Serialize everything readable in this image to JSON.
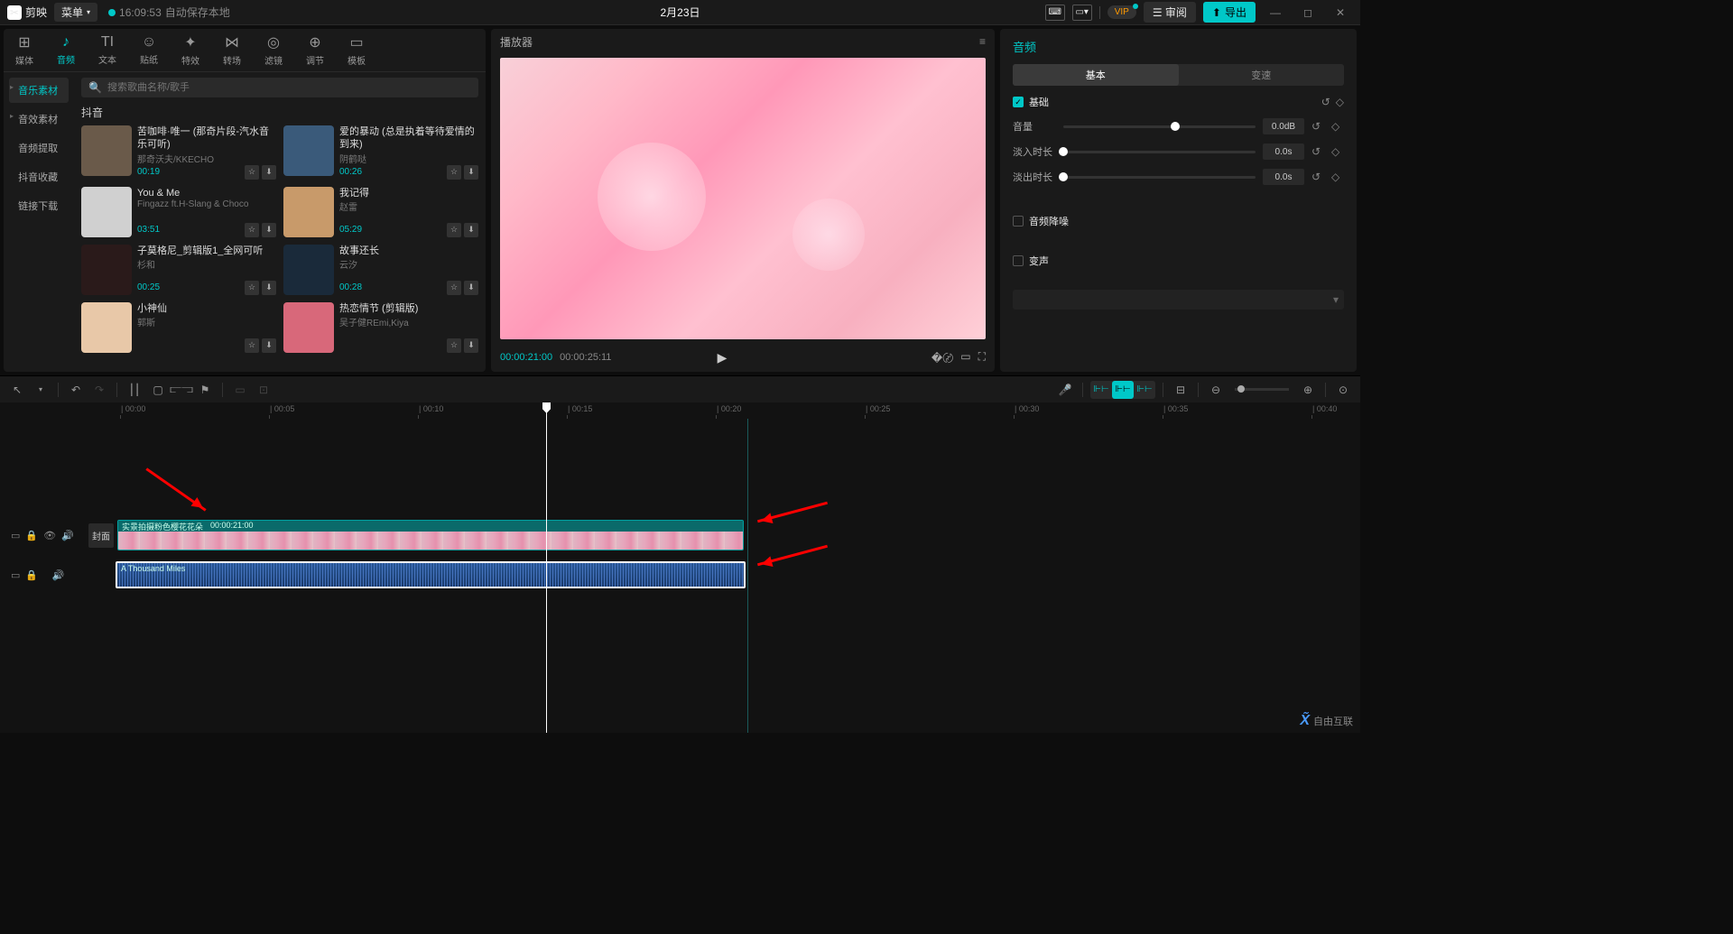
{
  "titlebar": {
    "app_name": "剪映",
    "menu": "菜单",
    "autosave_time": "16:09:53",
    "autosave_text": "自动保存本地",
    "project_title": "2月23日",
    "vip": "VIP",
    "review": "审阅",
    "export": "导出"
  },
  "top_tabs": [
    {
      "icon": "⊞",
      "label": "媒体"
    },
    {
      "icon": "♪",
      "label": "音频"
    },
    {
      "icon": "TI",
      "label": "文本"
    },
    {
      "icon": "☺",
      "label": "贴纸"
    },
    {
      "icon": "✦",
      "label": "特效"
    },
    {
      "icon": "⋈",
      "label": "转场"
    },
    {
      "icon": "◎",
      "label": "滤镜"
    },
    {
      "icon": "⊕",
      "label": "调节"
    },
    {
      "icon": "▭",
      "label": "模板"
    }
  ],
  "side_nav": [
    {
      "label": "音乐素材",
      "active": true,
      "expandable": true
    },
    {
      "label": "音效素材",
      "expandable": true
    },
    {
      "label": "音频提取"
    },
    {
      "label": "抖音收藏"
    },
    {
      "label": "链接下载"
    }
  ],
  "search": {
    "placeholder": "搜索歌曲名称/歌手"
  },
  "section_title": "抖音",
  "music": [
    {
      "name": "苦咖啡·唯一 (那奇片段-汽水音乐可听)",
      "artist": "那奇沃夫/KKECHO",
      "dur": "00:19"
    },
    {
      "name": "爱的暴动 (总是执着等待爱情的到来)",
      "artist": "阴鹤哒",
      "dur": "00:26"
    },
    {
      "name": "You & Me",
      "artist": "Fingazz ft.H-Slang & Choco",
      "dur": "03:51"
    },
    {
      "name": "我记得",
      "artist": "赵雷",
      "dur": "05:29"
    },
    {
      "name": "子莫格尼_剪辑版1_全网可听",
      "artist": "杉和",
      "dur": "00:25"
    },
    {
      "name": "故事还长",
      "artist": "云汐",
      "dur": "00:28"
    },
    {
      "name": "小神仙",
      "artist": "郭斯",
      "dur": ""
    },
    {
      "name": "热恋情节 (剪辑版)",
      "artist": "吴子健REmi,Kiya",
      "dur": ""
    }
  ],
  "player": {
    "title": "播放器",
    "current": "00:00:21:00",
    "total": "00:00:25:11"
  },
  "right": {
    "title": "音频",
    "tabs": [
      "基本",
      "变速"
    ],
    "basic": "基础",
    "volume": {
      "label": "音量",
      "value": "0.0dB",
      "pos": 58
    },
    "fadein": {
      "label": "淡入时长",
      "value": "0.0s",
      "pos": 0
    },
    "fadeout": {
      "label": "淡出时长",
      "value": "0.0s",
      "pos": 0
    },
    "denoise": "音频降噪",
    "voice_change": "变声"
  },
  "ruler": [
    "00:00",
    "00:05",
    "00:10",
    "00:15",
    "00:20",
    "00:25",
    "00:30",
    "00:35",
    "00:40"
  ],
  "timeline": {
    "cover": "封面",
    "video_clip": {
      "name": "实景拍摄粉色樱花花朵",
      "dur": "00:00:21:00"
    },
    "audio_clip": {
      "name": "A Thousand Miles"
    }
  },
  "watermark": "自由互联"
}
